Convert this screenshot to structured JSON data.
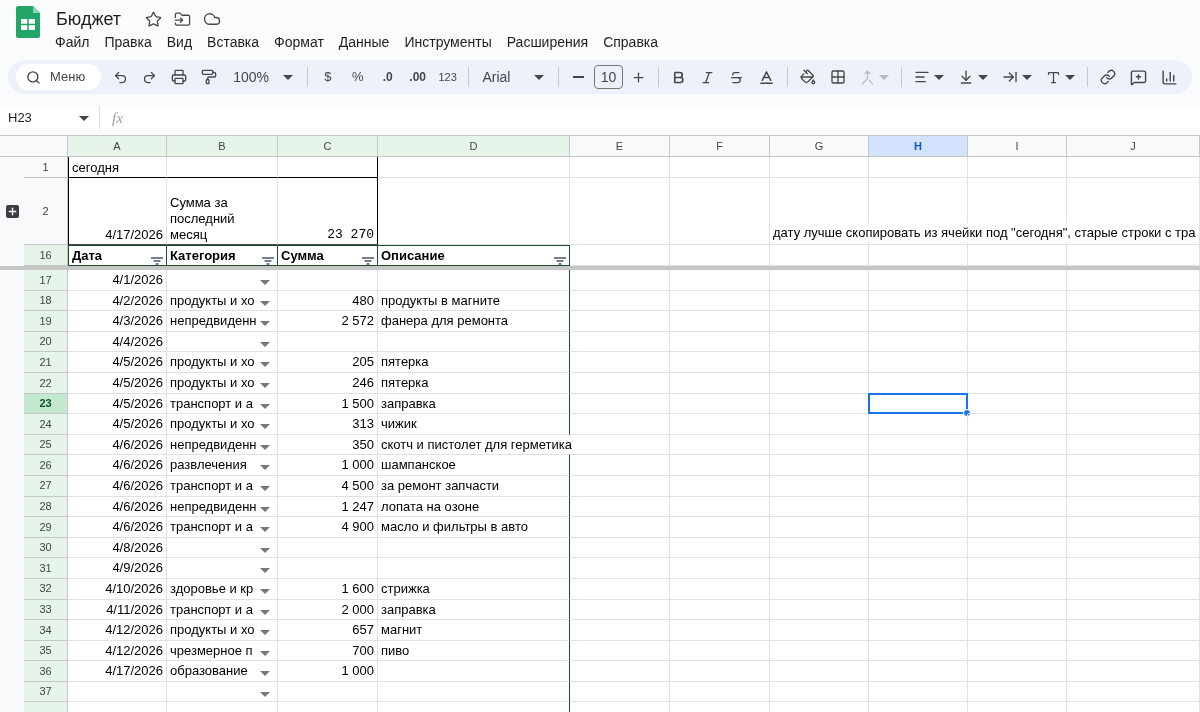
{
  "document": {
    "title": "Бюджет"
  },
  "menu": [
    "Файл",
    "Правка",
    "Вид",
    "Вставка",
    "Формат",
    "Данные",
    "Инструменты",
    "Расширения",
    "Справка"
  ],
  "toolbar": {
    "menu_search": "Меню",
    "zoom": "100%",
    "currency": "$",
    "percent": "%",
    "decrease_decimals": ".0",
    "increase_decimals": ".00",
    "number_format": "123",
    "font": "Arial",
    "font_size": "10"
  },
  "formula_bar": {
    "name_box": "H23",
    "function_label": "fx"
  },
  "columns": [
    {
      "label": "A",
      "selected": false,
      "filtered": true
    },
    {
      "label": "B",
      "selected": false,
      "filtered": true
    },
    {
      "label": "C",
      "selected": false,
      "filtered": true
    },
    {
      "label": "D",
      "selected": false,
      "filtered": true
    },
    {
      "label": "E",
      "selected": false,
      "filtered": false
    },
    {
      "label": "F",
      "selected": false,
      "filtered": false
    },
    {
      "label": "G",
      "selected": false,
      "filtered": false
    },
    {
      "label": "H",
      "selected": true,
      "filtered": false
    },
    {
      "label": "I",
      "selected": false,
      "filtered": false
    },
    {
      "label": "J",
      "selected": false,
      "filtered": false
    }
  ],
  "row_1": {
    "number": "1",
    "a": "сегодня"
  },
  "row_2": {
    "number": "2",
    "a": "4/17/2026",
    "b": "Сумма за последний месяц",
    "c": "23 270",
    "g": "дату лучше скопировать из ячейки под \"сегодня\", старые строки с тра"
  },
  "table_header": {
    "number": "16",
    "columns": [
      "Дата",
      "Категория",
      "Сумма",
      "Описание"
    ]
  },
  "rows": [
    {
      "number": "17",
      "selected": false,
      "date": "4/1/2026",
      "dropdown": true
    },
    {
      "number": "18",
      "selected": false,
      "date": "4/2/2026",
      "category": "продукты и хо",
      "amount": "480",
      "description": "продукты в магните",
      "dropdown": true
    },
    {
      "number": "19",
      "selected": false,
      "date": "4/3/2026",
      "category": "непредвиденн",
      "amount": "2 572",
      "description": "фанера для ремонта",
      "dropdown": true
    },
    {
      "number": "20",
      "selected": false,
      "date": "4/4/2026",
      "dropdown": true
    },
    {
      "number": "21",
      "selected": false,
      "date": "4/5/2026",
      "category": "продукты и хо",
      "amount": "205",
      "description": "пятерка",
      "dropdown": true
    },
    {
      "number": "22",
      "selected": false,
      "date": "4/5/2026",
      "category": "продукты и хо",
      "amount": "246",
      "description": "пятерка",
      "dropdown": true
    },
    {
      "number": "23",
      "selected": true,
      "date": "4/5/2026",
      "category": "транспорт и а",
      "amount": "1 500",
      "description": "заправка",
      "dropdown": true
    },
    {
      "number": "24",
      "selected": false,
      "date": "4/5/2026",
      "category": "продукты и хо",
      "amount": "313",
      "description": "чижик",
      "dropdown": true
    },
    {
      "number": "25",
      "selected": false,
      "date": "4/6/2026",
      "category": "непредвиденн",
      "amount": "350",
      "description": "скотч и пистолет для герметика",
      "dropdown": true
    },
    {
      "number": "26",
      "selected": false,
      "date": "4/6/2026",
      "category": "развлечения",
      "amount": "1 000",
      "description": "шампанское",
      "dropdown": true
    },
    {
      "number": "27",
      "selected": false,
      "date": "4/6/2026",
      "category": "транспорт и а",
      "amount": "4 500",
      "description": "за ремонт запчасти",
      "dropdown": true
    },
    {
      "number": "28",
      "selected": false,
      "date": "4/6/2026",
      "category": "непредвиденн",
      "amount": "1 247",
      "description": "лопата на озоне",
      "dropdown": true
    },
    {
      "number": "29",
      "selected": false,
      "date": "4/6/2026",
      "category": "транспорт и а",
      "amount": "4 900",
      "description": "масло и фильтры в авто",
      "dropdown": true
    },
    {
      "number": "30",
      "selected": false,
      "date": "4/8/2026",
      "dropdown": true
    },
    {
      "number": "31",
      "selected": false,
      "date": "4/9/2026",
      "dropdown": true
    },
    {
      "number": "32",
      "selected": false,
      "date": "4/10/2026",
      "category": "здоровье и кр",
      "amount": "1 600",
      "description": "стрижка",
      "dropdown": true
    },
    {
      "number": "33",
      "selected": false,
      "date": "4/11/2026",
      "category": "транспорт и а",
      "amount": "2 000",
      "description": "заправка",
      "dropdown": true
    },
    {
      "number": "34",
      "selected": false,
      "date": "4/12/2026",
      "category": "продукты и хо",
      "amount": "657",
      "description": "магнит",
      "dropdown": true
    },
    {
      "number": "35",
      "selected": false,
      "date": "4/12/2026",
      "category": "чрезмерное п",
      "amount": "700",
      "description": "пиво",
      "dropdown": true
    },
    {
      "number": "36",
      "selected": false,
      "date": "4/17/2026",
      "category": "образование",
      "amount": "1 000",
      "dropdown": true
    },
    {
      "number": "37",
      "selected": false,
      "dropdown": true
    }
  ]
}
